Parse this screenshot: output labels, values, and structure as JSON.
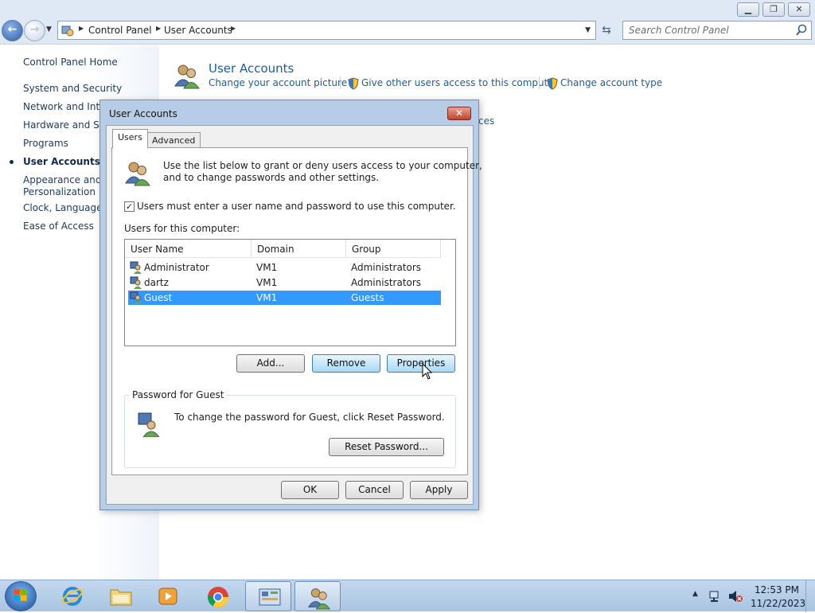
{
  "explorer": {
    "breadcrumb": [
      "Control Panel",
      "User Accounts"
    ],
    "search_placeholder": "Search Control Panel",
    "left_nav": {
      "home": "Control Panel Home",
      "items": [
        "System and Security",
        "Network and Inter",
        "Hardware and Sou",
        "Programs",
        "User Accounts",
        "Appearance and",
        "Personalization",
        "Clock, Language, a",
        "Ease of Access"
      ],
      "current_index": 4
    },
    "main": {
      "heading": "User Accounts",
      "links": [
        "Change your account picture",
        "Give other users access to this computer",
        "Change account type"
      ],
      "partial_link": "ces"
    }
  },
  "dialog": {
    "title": "User Accounts",
    "tabs": [
      "Users",
      "Advanced"
    ],
    "selected_tab": "Users",
    "intro_line1": "Use the list below to grant or deny users access to your computer,",
    "intro_line2": "and to change passwords and other settings.",
    "checkbox_label": "Users must enter a user name and password to use this computer.",
    "checkbox_checked": true,
    "users_label": "Users for this computer:",
    "columns": [
      "User Name",
      "Domain",
      "Group"
    ],
    "rows": [
      {
        "name": "Administrator",
        "domain": "VM1",
        "group": "Administrators"
      },
      {
        "name": "dartz",
        "domain": "VM1",
        "group": "Administrators"
      },
      {
        "name": "Guest",
        "domain": "VM1",
        "group": "Guests"
      }
    ],
    "selected_row": 2,
    "buttons": {
      "add": "Add...",
      "remove": "Remove",
      "properties": "Properties"
    },
    "password_group": {
      "legend": "Password for Guest",
      "text": "To change the password for Guest, click Reset Password.",
      "reset_button": "Reset Password..."
    },
    "footer": {
      "ok": "OK",
      "cancel": "Cancel",
      "apply": "Apply"
    }
  },
  "taskbar": {
    "apps": [
      "internet-explorer",
      "windows-explorer",
      "media-player",
      "chrome",
      "control-panel",
      "user-accounts"
    ],
    "time": "12:53 PM",
    "date": "11/22/2023"
  },
  "colors": {
    "accent": "#3399ff",
    "link": "#1e5c98",
    "taskbar": "#b4cde8"
  }
}
